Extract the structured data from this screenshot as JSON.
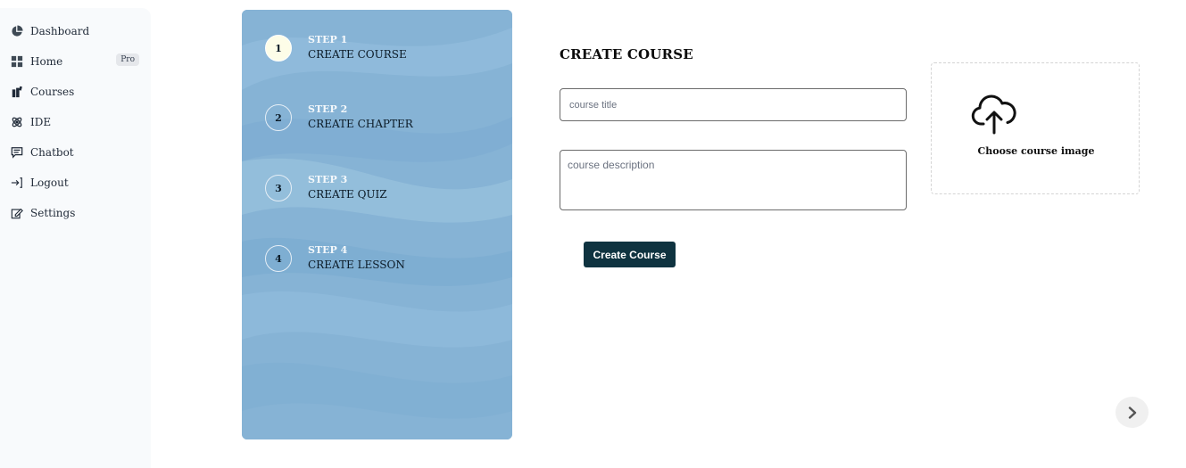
{
  "sidebar": {
    "items": [
      {
        "label": "Dashboard",
        "icon": "pie-chart-icon"
      },
      {
        "label": "Home",
        "icon": "grid-icon",
        "badge": "Pro"
      },
      {
        "label": "Courses",
        "icon": "books-icon"
      },
      {
        "label": "IDE",
        "icon": "atom-icon"
      },
      {
        "label": "Chatbot",
        "icon": "chat-icon"
      },
      {
        "label": "Logout",
        "icon": "logout-icon"
      },
      {
        "label": "Settings",
        "icon": "edit-settings-icon"
      }
    ]
  },
  "steps": [
    {
      "number": "1",
      "label": "STEP 1",
      "name": "CREATE COURSE",
      "active": true
    },
    {
      "number": "2",
      "label": "STEP 2",
      "name": "CREATE CHAPTER",
      "active": false
    },
    {
      "number": "3",
      "label": "STEP 3",
      "name": "CREATE QUIZ",
      "active": false
    },
    {
      "number": "4",
      "label": "STEP 4",
      "name": "CREATE LESSON",
      "active": false
    }
  ],
  "form": {
    "title": "CREATE COURSE",
    "course_title_placeholder": "course title",
    "course_title_value": "",
    "course_description_placeholder": "course description",
    "course_description_value": "",
    "submit_label": "Create Course"
  },
  "upload": {
    "label": "Choose course image",
    "icon": "cloud-upload-icon"
  },
  "navigation": {
    "next_icon": "chevron-right-icon"
  },
  "colors": {
    "panel_blue": "#86b3d5",
    "button_dark": "#0f3340",
    "active_step": "#fdfde8"
  }
}
